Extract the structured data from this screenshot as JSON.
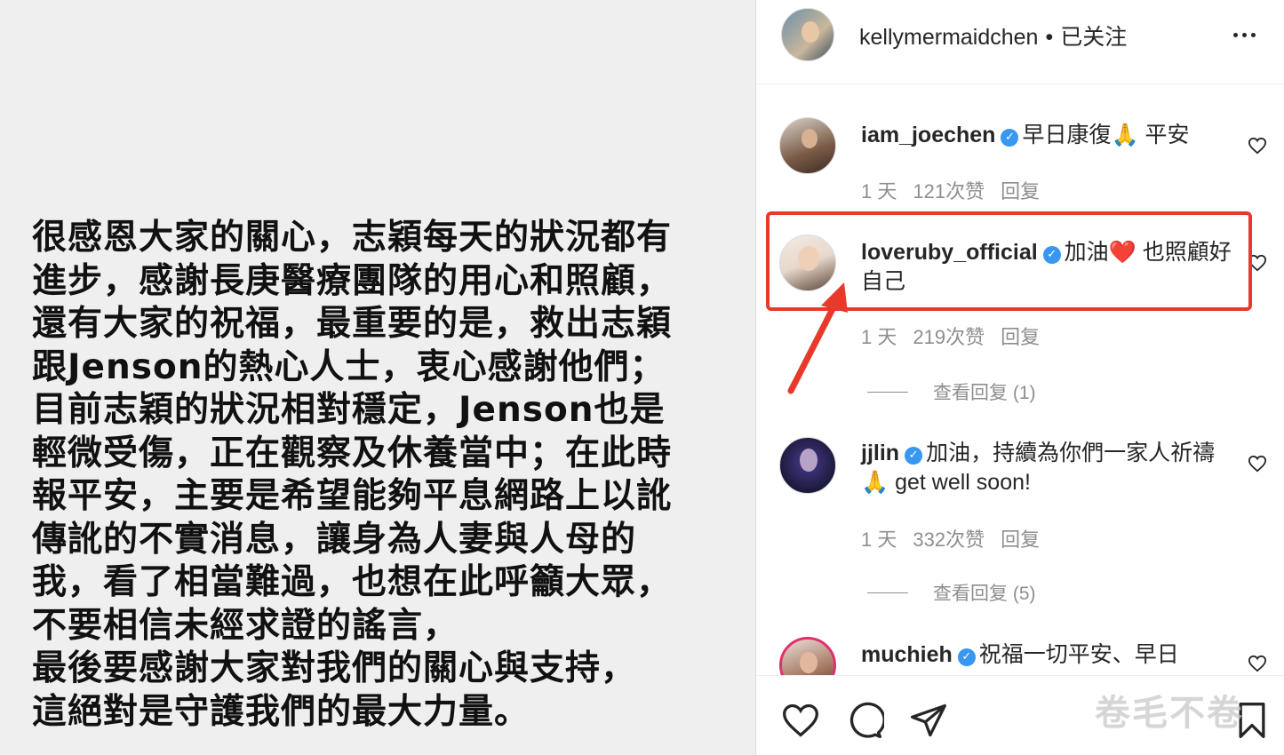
{
  "post": {
    "lines": [
      "很感恩大家的關心，志穎每天的狀況都有",
      "進步，感謝長庚醫療團隊的用心和照顧，",
      "還有大家的祝福，最重要的是，救出志穎",
      "跟Jenson的熱心人士，衷心感謝他們；",
      "目前志穎的狀況相對穩定，Jenson也是",
      "輕微受傷，正在觀察及休養當中；在此時",
      "報平安，主要是希望能夠平息網路上以訛",
      "傳訛的不實消息，讓身為人妻與人母的",
      "我，看了相當難過，也想在此呼籲大眾，",
      "不要相信未經求證的謠言，",
      "最後要感謝大家對我們的關心與支持，",
      "這絕對是守護我們的最大力量。"
    ]
  },
  "header": {
    "username": "kellymermaidchen",
    "separator": "•",
    "follow_status": "已关注"
  },
  "comments": [
    {
      "username": "iam_joechen",
      "text": "早日康復🙏 平安",
      "time": "1 天",
      "likes": "121次赞",
      "reply": "回复"
    },
    {
      "username": "loveruby_official",
      "text": "加油❤️  也照顧好自己",
      "time": "1 天",
      "likes": "219次赞",
      "reply": "回复",
      "view_replies": "查看回复 (1)"
    },
    {
      "username": "jjlin",
      "text": "加油，持續為你們一家人祈禱🙏  get well soon!",
      "time": "1 天",
      "likes": "332次赞",
      "reply": "回复",
      "view_replies": "查看回复 (5)"
    },
    {
      "username": "muchieh",
      "text": "祝福一切平安、早日"
    }
  ],
  "watermark": "卷毛不卷",
  "colors": {
    "highlight": "#e8392b",
    "verified": "#3897f0",
    "muted": "#8e8e8e"
  }
}
